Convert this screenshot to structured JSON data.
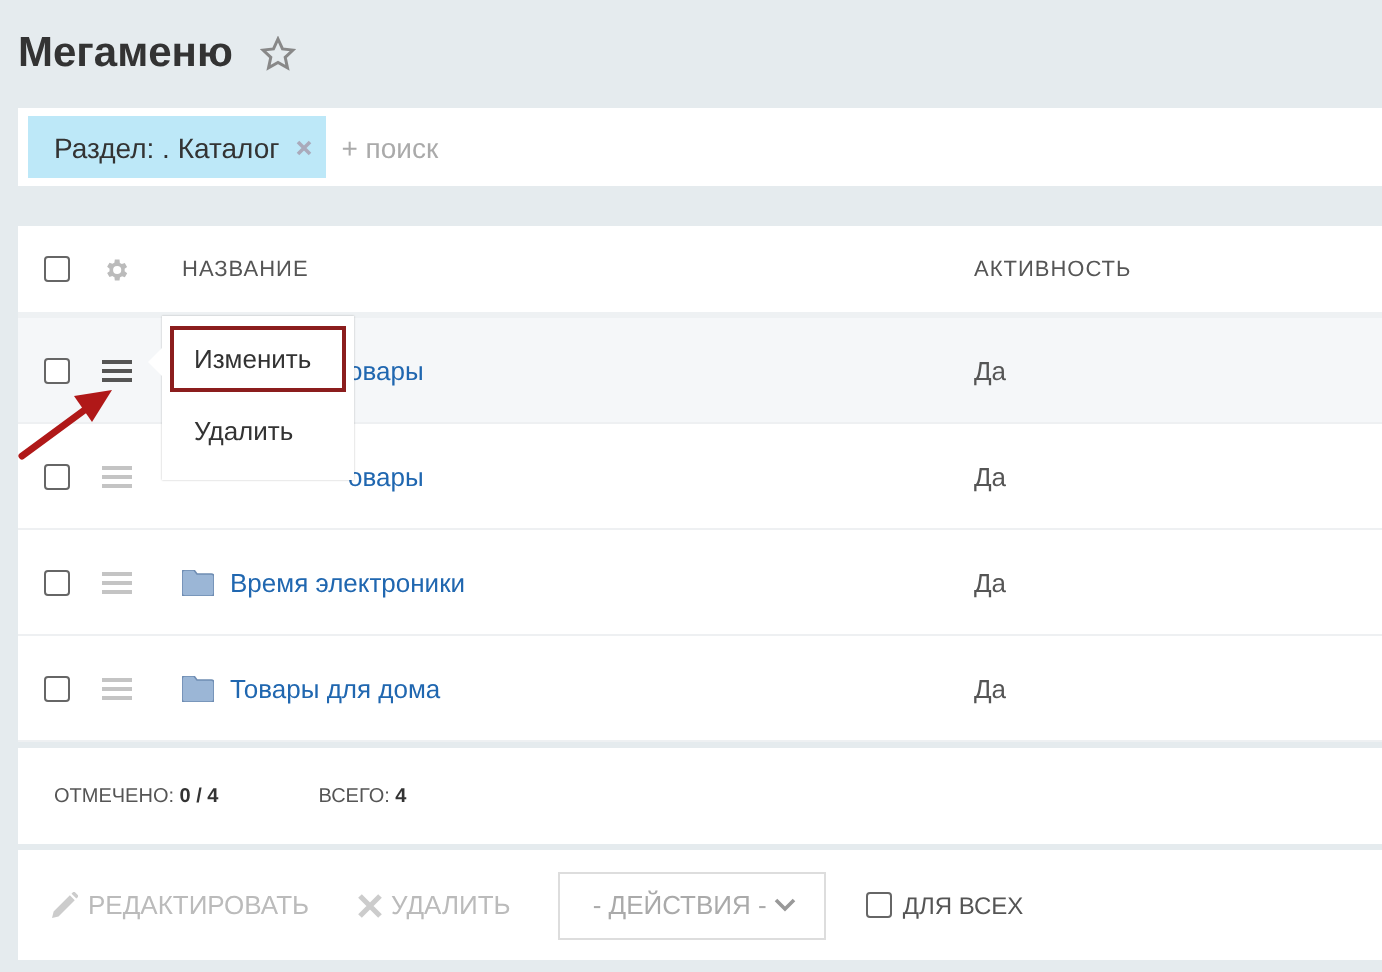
{
  "title": "Мегаменю",
  "favorite": false,
  "filter": {
    "tag": "Раздел: . Каталог",
    "placeholder": "+ поиск"
  },
  "table": {
    "select_all_checked": false,
    "columns": [
      "НАЗВАНИЕ",
      "АКТИВНОСТЬ"
    ],
    "rows": [
      {
        "name": "овары",
        "active": "Да",
        "checked": false,
        "highlighted": true,
        "kind": "covered"
      },
      {
        "name": "овары",
        "active": "Да",
        "checked": false,
        "highlighted": false,
        "kind": "covered"
      },
      {
        "name": "Время электроники",
        "active": "Да",
        "checked": false,
        "highlighted": false,
        "kind": "folder"
      },
      {
        "name": "Товары для дома",
        "active": "Да",
        "checked": false,
        "highlighted": false,
        "kind": "folder"
      }
    ]
  },
  "context_menu": {
    "items": [
      {
        "label": "Изменить",
        "selected": true
      },
      {
        "label": "Удалить",
        "selected": false
      }
    ]
  },
  "summary": {
    "checked_label": "ОТМЕЧЕНО:",
    "checked_value": "0 / 4",
    "total_label": "ВСЕГО:",
    "total_value": "4"
  },
  "actions": {
    "edit": "РЕДАКТИРОВАТЬ",
    "delete": "УДАЛИТЬ",
    "dropdown": "- ДЕЙСТВИЯ -",
    "for_all": "ДЛЯ ВСЕХ",
    "for_all_checked": false
  }
}
